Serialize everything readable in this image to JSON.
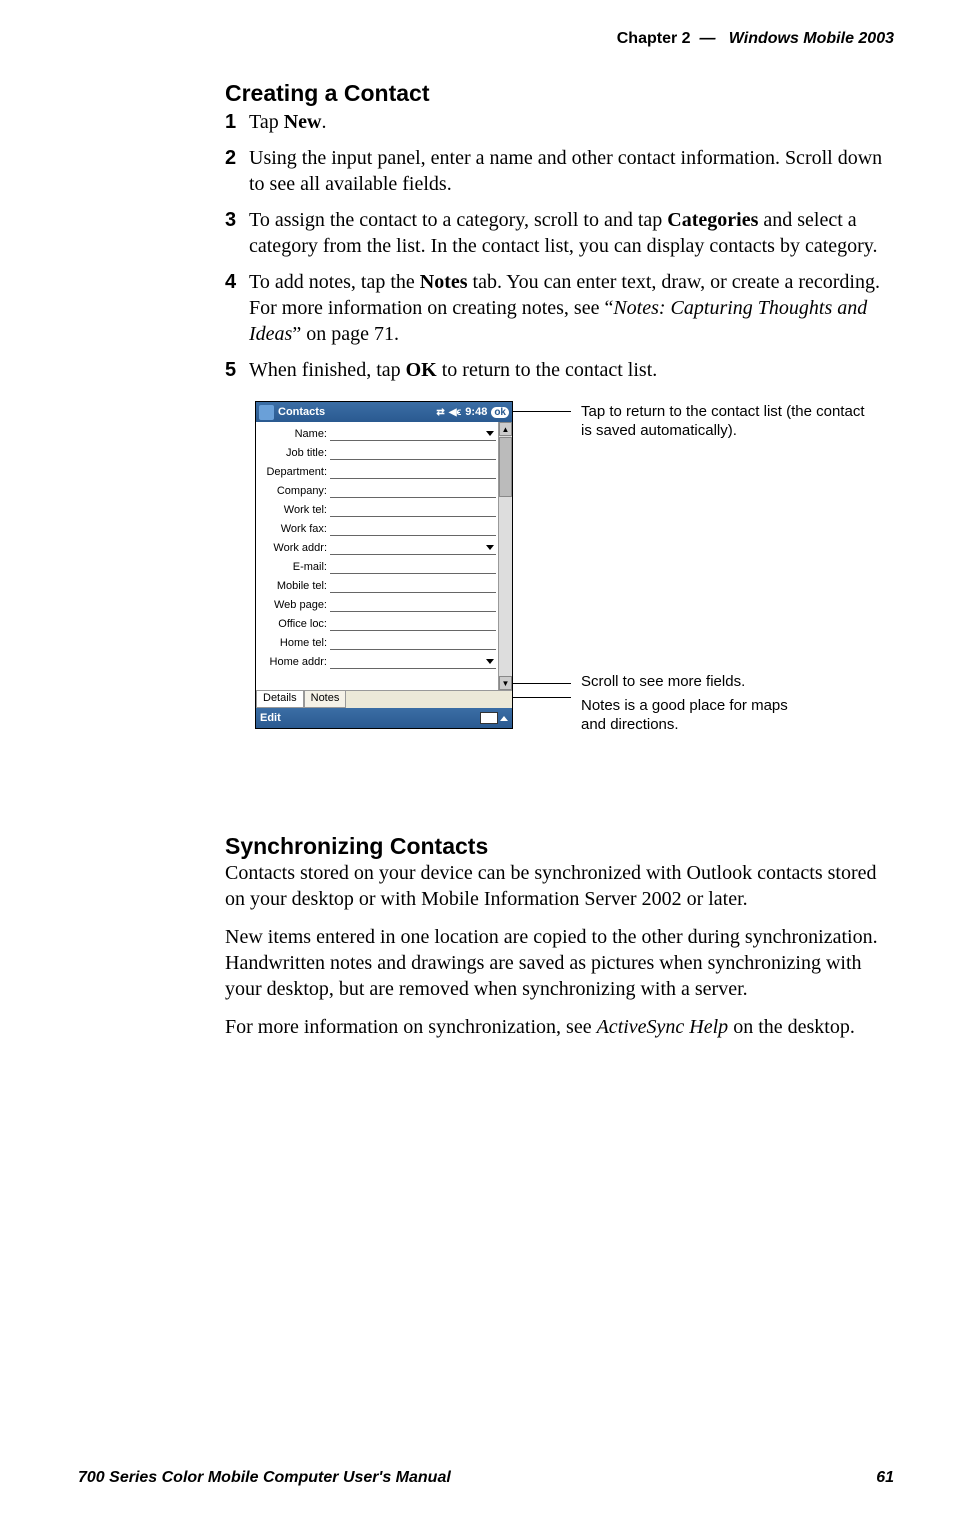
{
  "header": {
    "chapter_label": "Chapter",
    "chapter_num": "2",
    "dash": "—",
    "book_title": "Windows Mobile 2003"
  },
  "section1_title": "Creating a Contact",
  "steps": [
    {
      "n": "1",
      "html": "Tap <b>New</b>."
    },
    {
      "n": "2",
      "html": "Using the input panel, enter a name and other contact information. Scroll down to see all available fields."
    },
    {
      "n": "3",
      "html": "To assign the contact to a category, scroll to and tap <b>Categories</b> and select a category from the list. In the contact list, you can display contacts by category."
    },
    {
      "n": "4",
      "html": "To add notes, tap the <b>Notes</b> tab. You can enter text, draw, or create a recording. For more information on creating notes, see “<i>Notes: Capturing Thoughts and Ideas</i>” on page 71."
    },
    {
      "n": "5",
      "html": "When finished, tap <b>OK</b> to return to the contact list."
    }
  ],
  "device": {
    "app_title": "Contacts",
    "clock": "9:48",
    "ok_label": "ok",
    "fields": [
      {
        "label": "Name:",
        "dropdown": true
      },
      {
        "label": "Job title:",
        "dropdown": false
      },
      {
        "label": "Department:",
        "dropdown": false
      },
      {
        "label": "Company:",
        "dropdown": false
      },
      {
        "label": "Work tel:",
        "dropdown": false
      },
      {
        "label": "Work fax:",
        "dropdown": false
      },
      {
        "label": "Work addr:",
        "dropdown": true
      },
      {
        "label": "E-mail:",
        "dropdown": false
      },
      {
        "label": "Mobile tel:",
        "dropdown": false
      },
      {
        "label": "Web page:",
        "dropdown": false
      },
      {
        "label": "Office loc:",
        "dropdown": false
      },
      {
        "label": "Home tel:",
        "dropdown": false
      },
      {
        "label": "Home addr:",
        "dropdown": true
      }
    ],
    "tabs": {
      "details": "Details",
      "notes": "Notes"
    },
    "bottom": {
      "edit": "Edit"
    }
  },
  "annotations": {
    "a1": "Tap to return to the contact list (the contact is saved automatically).",
    "a2": "Scroll to see more fields.",
    "a3": "Notes is a good place for maps and directions."
  },
  "section2_title": "Synchronizing Contacts",
  "sync_paras": [
    "Contacts stored on your device can be synchronized with Outlook contacts stored on your desktop or with Mobile Information Server 2002 or later.",
    "New items entered in one location are copied to the other during synchronization. Handwritten notes and drawings are saved as pictures when synchronizing with your desktop, but are removed when synchronizing with a server.",
    {
      "html": "For more information on synchronization, see <i>ActiveSync Help</i> on the desktop."
    }
  ],
  "footer": {
    "manual_title": "700 Series Color Mobile Computer User's Manual",
    "page_num": "61"
  }
}
